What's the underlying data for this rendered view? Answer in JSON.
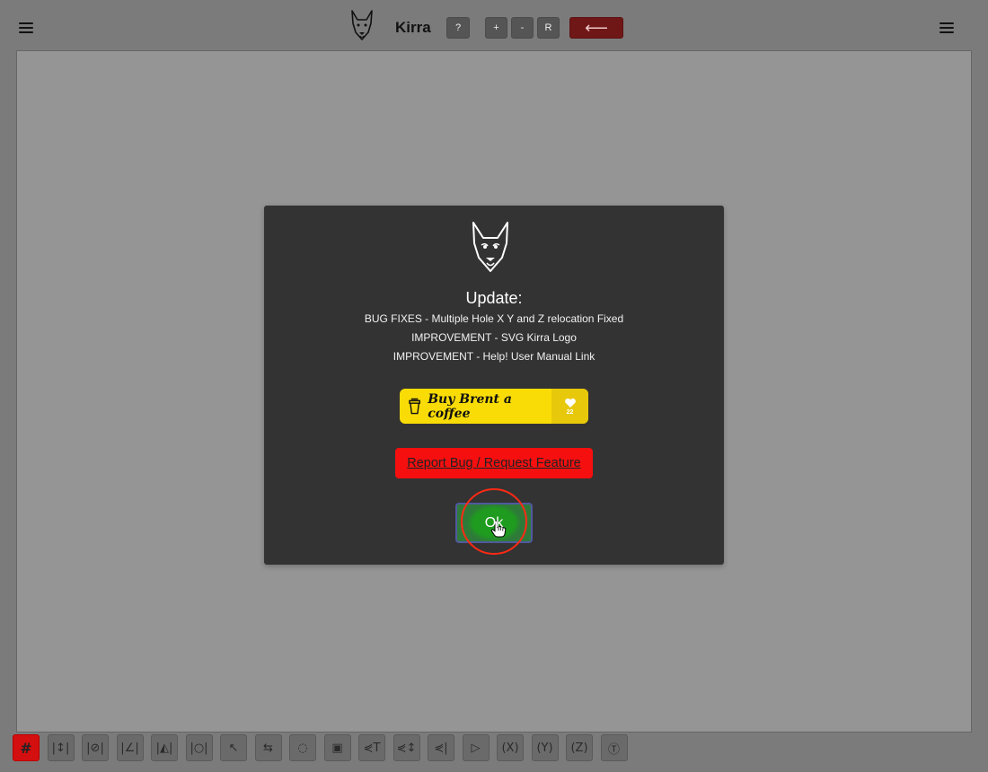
{
  "app": {
    "name": "Kirra"
  },
  "header": {
    "help_label": "?",
    "zoom_in_label": "+",
    "zoom_out_label": "-",
    "reset_label": "R",
    "back_label": "⟵"
  },
  "toolbar": {
    "tools": [
      {
        "name": "grid-tool",
        "glyph": "#"
      },
      {
        "name": "tool-2",
        "glyph": "|↕|"
      },
      {
        "name": "tool-3",
        "glyph": "|⊘|"
      },
      {
        "name": "tool-4",
        "glyph": "|∠|"
      },
      {
        "name": "tool-5",
        "glyph": "|◭|"
      },
      {
        "name": "tool-6",
        "glyph": "|○|"
      },
      {
        "name": "tool-7",
        "glyph": "↖"
      },
      {
        "name": "tool-8",
        "glyph": "⇆"
      },
      {
        "name": "tool-9",
        "glyph": "◌"
      },
      {
        "name": "tool-10",
        "glyph": "▣"
      },
      {
        "name": "tool-11",
        "glyph": "⋞T"
      },
      {
        "name": "tool-12",
        "glyph": "⋞↕"
      },
      {
        "name": "tool-13",
        "glyph": "⋞|"
      },
      {
        "name": "tool-14",
        "glyph": "▷"
      },
      {
        "name": "tool-15",
        "glyph": "(X)"
      },
      {
        "name": "tool-16",
        "glyph": "(Y)"
      },
      {
        "name": "tool-17",
        "glyph": "(Z)"
      },
      {
        "name": "tool-18",
        "glyph": "Ⓣ"
      }
    ]
  },
  "modal": {
    "title": "Update:",
    "lines": [
      "BUG FIXES - Multiple Hole X Y and Z relocation Fixed",
      "IMPROVEMENT - SVG Kirra Logo",
      "IMPROVEMENT - Help! User Manual Link"
    ],
    "coffee_label": "Buy Brent a coffee",
    "coffee_count": "22",
    "report_label": "Report Bug / Request Feature",
    "ok_label": "Ok"
  },
  "colors": {
    "back_button": "#6f1616",
    "coffee": "#f9dc06",
    "report": "#f50f0f",
    "ok": "#1f9c1f",
    "active_tool": "#d40f0f"
  }
}
